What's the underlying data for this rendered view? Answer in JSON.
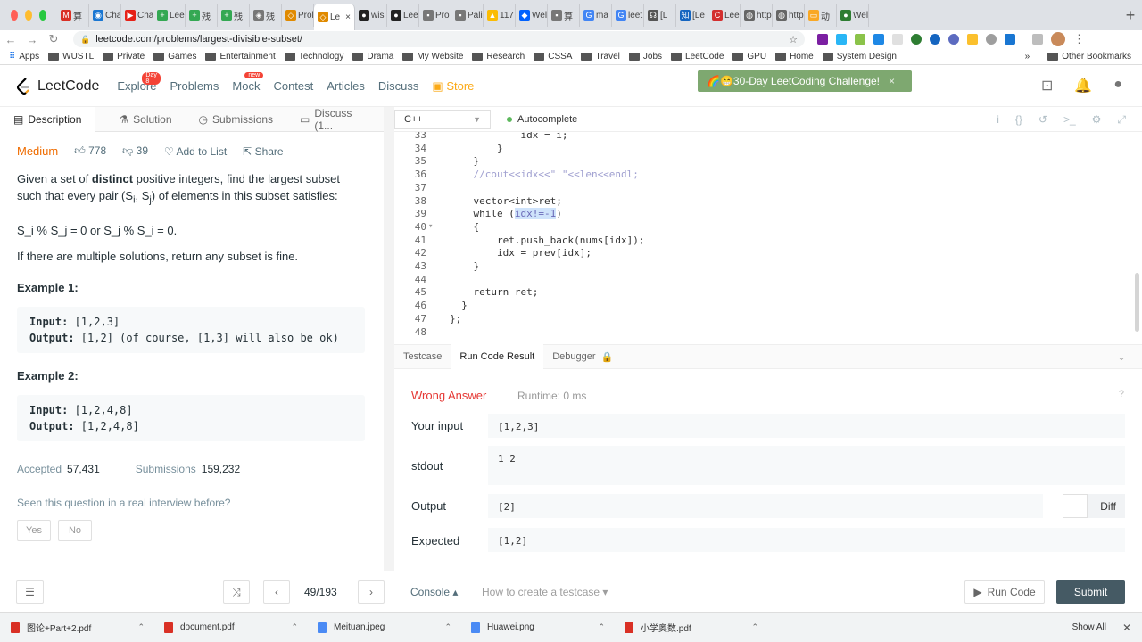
{
  "browser": {
    "tabs": [
      {
        "label": "算",
        "color": "#d93025",
        "glyph": "M"
      },
      {
        "label": "Cha",
        "color": "#1976d2",
        "glyph": "◉"
      },
      {
        "label": "Cha",
        "color": "#e62117",
        "glyph": "▶"
      },
      {
        "label": "Lee",
        "color": "#34a853",
        "glyph": "+"
      },
      {
        "label": "残",
        "color": "#34a853",
        "glyph": "+"
      },
      {
        "label": "残",
        "color": "#34a853",
        "glyph": "+"
      },
      {
        "label": "残",
        "color": "#777777",
        "glyph": "◈"
      },
      {
        "label": "Prol",
        "color": "#e08a00",
        "glyph": "◇"
      },
      {
        "label": "Le",
        "color": "#e08a00",
        "glyph": "◇"
      },
      {
        "label": "wis",
        "color": "#222222",
        "glyph": "●"
      },
      {
        "label": "Lee",
        "color": "#222222",
        "glyph": "●"
      },
      {
        "label": "Pro",
        "color": "#777777",
        "glyph": "▪"
      },
      {
        "label": "Pali",
        "color": "#777777",
        "glyph": "▪"
      },
      {
        "label": "117",
        "color": "#fbbc04",
        "glyph": "▲"
      },
      {
        "label": "Wel",
        "color": "#0061fe",
        "glyph": "◆"
      },
      {
        "label": "算",
        "color": "#777777",
        "glyph": "▪"
      },
      {
        "label": "ma",
        "color": "#4285f4",
        "glyph": "G"
      },
      {
        "label": "leet",
        "color": "#4285f4",
        "glyph": "G"
      },
      {
        "label": "[L",
        "color": "#555555",
        "glyph": "☊"
      },
      {
        "label": "[Le",
        "color": "#1565c0",
        "glyph": "知"
      },
      {
        "label": "Lee",
        "color": "#d32f2f",
        "glyph": "C"
      },
      {
        "label": "http",
        "color": "#666666",
        "glyph": "◍"
      },
      {
        "label": "http",
        "color": "#666666",
        "glyph": "◍"
      },
      {
        "label": "动",
        "color": "#f9a825",
        "glyph": "▭"
      },
      {
        "label": "Wel",
        "color": "#2e7d32",
        "glyph": "●"
      }
    ],
    "new_tab": "+",
    "url": "leetcode.com/problems/largest-divisible-subset/",
    "nav_back": "←",
    "nav_forward": "→",
    "nav_reload": "↻",
    "bookmarks": [
      "Apps",
      "WUSTL",
      "Private",
      "Games",
      "Entertainment",
      "Technology",
      "Drama",
      "My Website",
      "Research",
      "CSSA",
      "Travel",
      "Jobs",
      "LeetCode",
      "GPU",
      "Home",
      "System Design"
    ],
    "bookmarks_more": "»",
    "other_bookmarks": "Other Bookmarks"
  },
  "lc_nav": {
    "logo": "LeetCode",
    "links": [
      "Explore",
      "Problems",
      "Mock",
      "Contest",
      "Articles",
      "Discuss"
    ],
    "explore_badge": "Day 8",
    "mock_badge": "new",
    "store": "Store",
    "challenge": "30-Day LeetCoding Challenge!",
    "challenge_close": "×"
  },
  "left_tabs": [
    "Description",
    "Solution",
    "Submissions",
    "Discuss (1..."
  ],
  "problem": {
    "difficulty": "Medium",
    "likes": "778",
    "dislikes": "39",
    "add_to_list": "Add to List",
    "share": "Share",
    "desc_before": "Given a set of ",
    "desc_bold": "distinct",
    "desc_after": " positive integers, find the largest subset such that every pair (S",
    "desc_i": "i",
    "desc_comma": ", S",
    "desc_j": "j",
    "desc_end": ") of elements in this subset satisfies:",
    "condition": "S_i % S_j = 0 or S_j % S_i = 0.",
    "multiple": "If there are multiple solutions, return any subset is fine.",
    "example1_title": "Example 1:",
    "example1_input_label": "Input:",
    "example1_input": " [1,2,3]",
    "example1_output_label": "Output:",
    "example1_output": " [1,2] (of course, [1,3] will also be ok)",
    "example2_title": "Example 2:",
    "example2_input_label": "Input:",
    "example2_input": " [1,2,4,8]",
    "example2_output_label": "Output:",
    "example2_output": " [1,2,4,8]",
    "accepted_label": "Accepted",
    "accepted": "57,431",
    "submissions_label": "Submissions",
    "submissions": "159,232",
    "seen": "Seen this question in a real interview before?",
    "yes": "Yes",
    "no": "No"
  },
  "editor": {
    "language": "C++",
    "autocomplete": "Autocomplete",
    "lines": [
      {
        "n": "33",
        "t": "            idx = i;"
      },
      {
        "n": "34",
        "t": "        }"
      },
      {
        "n": "35",
        "t": "    }"
      },
      {
        "n": "36",
        "t": "    //cout<<idx<<\" \"<<len<<endl;",
        "comment": true
      },
      {
        "n": "37",
        "t": ""
      },
      {
        "n": "38",
        "t": "    vector<int>ret;"
      },
      {
        "n": "39",
        "t": "    while (idx!=-1)",
        "hl": true
      },
      {
        "n": "40",
        "t": "    {",
        "fold": true
      },
      {
        "n": "41",
        "t": "        ret.push_back(nums[idx]);"
      },
      {
        "n": "42",
        "t": "        idx = prev[idx];"
      },
      {
        "n": "43",
        "t": "    }"
      },
      {
        "n": "44",
        "t": ""
      },
      {
        "n": "45",
        "t": "    return ret;"
      },
      {
        "n": "46",
        "t": "  }"
      },
      {
        "n": "47",
        "t": "};"
      },
      {
        "n": "48",
        "t": ""
      }
    ]
  },
  "result_tabs": [
    "Testcase",
    "Run Code Result",
    "Debugger"
  ],
  "result": {
    "status": "Wrong Answer",
    "runtime": "Runtime: 0 ms",
    "your_input_label": "Your input",
    "your_input": "[1,2,3]",
    "stdout_label": "stdout",
    "stdout": "1 2",
    "output_label": "Output",
    "output": "[2]",
    "expected_label": "Expected",
    "expected": "[1,2]",
    "diff": "Diff"
  },
  "bottom": {
    "page": "49/193",
    "console": "Console ▴",
    "howto": "How to create a testcase ▾",
    "run": "Run Code",
    "submit": "Submit"
  },
  "downloads": [
    "图论+Part+2.pdf",
    "document.pdf",
    "Meituan.jpeg",
    "Huawei.png",
    "小学奥数.pdf"
  ],
  "show_all": "Show All",
  "colors": {
    "accent": "#fbaa17",
    "wrong": "#e53935",
    "challenge": "#7ea870",
    "submit": "#455a64"
  }
}
